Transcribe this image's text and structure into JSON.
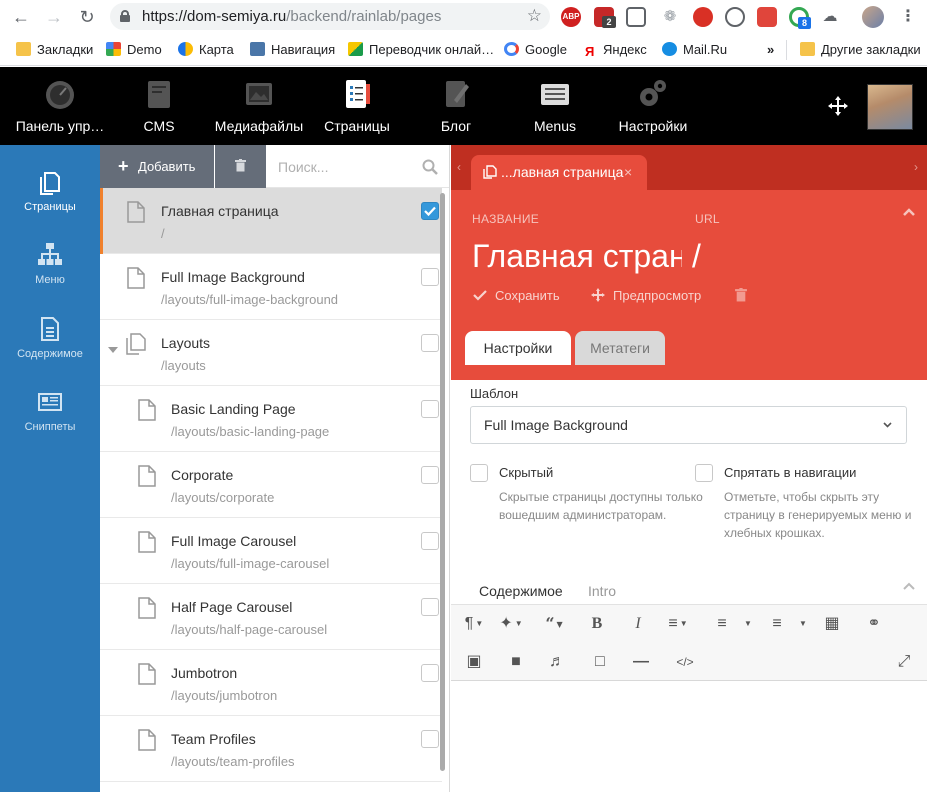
{
  "browser": {
    "url_host": "https://dom-semiya.ru",
    "url_path": "/backend/rainlab/pages",
    "extension_badge_1": "2",
    "extension_badge_2": "8",
    "adblock_label": "ABP",
    "bookmarks": [
      {
        "label": "Закладки"
      },
      {
        "label": "Demo"
      },
      {
        "label": "Карта"
      },
      {
        "label": "Навигация"
      },
      {
        "label": "Переводчик онлай…"
      },
      {
        "label": "Google"
      },
      {
        "label": "Яндекс"
      },
      {
        "label": "Mail.Ru"
      }
    ],
    "overflow_label": "»",
    "other_bookmarks": "Другие закладки"
  },
  "topnav": {
    "items": [
      {
        "label": "Панель упр…",
        "icon": "dashboard-gauge-icon"
      },
      {
        "label": "CMS",
        "icon": "cms-icon"
      },
      {
        "label": "Медиафайлы",
        "icon": "media-icon"
      },
      {
        "label": "Страницы",
        "icon": "pages-icon"
      },
      {
        "label": "Блог",
        "icon": "blog-icon"
      },
      {
        "label": "Menus",
        "icon": "menus-icon"
      },
      {
        "label": "Настройки",
        "icon": "settings-gears-icon"
      }
    ]
  },
  "sidenav": {
    "items": [
      {
        "label": "Страницы",
        "icon": "pages-icon"
      },
      {
        "label": "Меню",
        "icon": "sitemap-icon"
      },
      {
        "label": "Содержимое",
        "icon": "content-icon"
      },
      {
        "label": "Сниппеты",
        "icon": "snippets-icon"
      }
    ]
  },
  "panel": {
    "add_label": "Добавить",
    "search_placeholder": "Поиск...",
    "pages": [
      {
        "title": "Главная страница",
        "path": "/",
        "selected": true,
        "checked": true
      },
      {
        "title": "Full Image Background",
        "path": "/layouts/full-image-background"
      },
      {
        "title": "Layouts",
        "path": "/layouts",
        "folder": true
      },
      {
        "title": "Basic Landing Page",
        "path": "/layouts/basic-landing-page"
      },
      {
        "title": "Corporate",
        "path": "/layouts/corporate"
      },
      {
        "title": "Full Image Carousel",
        "path": "/layouts/full-image-carousel"
      },
      {
        "title": "Half Page Carousel",
        "path": "/layouts/half-page-carousel"
      },
      {
        "title": "Jumbotron",
        "path": "/layouts/jumbotron"
      },
      {
        "title": "Team Profiles",
        "path": "/layouts/team-profiles"
      }
    ]
  },
  "editor": {
    "tab_title": "...лавная страница",
    "tab_close": "×",
    "name_label": "НАЗВАНИЕ",
    "url_label": "URL",
    "title_value": "Главная страница",
    "url_value": "/",
    "save_label": "Сохранить",
    "preview_label": "Предпросмотр",
    "form_tabs": [
      "Настройки",
      "Метатеги"
    ],
    "layout_label": "Шаблон",
    "layout_value": "Full Image Background",
    "hidden_title": "Скрытый",
    "hidden_help": "Скрытые страницы доступны только вошедшим администраторам.",
    "hide_nav_title": "Спрятать в навигации",
    "hide_nav_help": "Отметьте, чтобы скрыть эту страницу в генерируемых меню и хлебных крошках.",
    "content_tabs": [
      "Содержимое",
      "Intro"
    ]
  },
  "colors": {
    "topbar": "#000000",
    "sidenav": "#2b79b8",
    "editor_header": "#e74c3c",
    "editor_tabbar": "#bf2f21",
    "selected_accent": "#f0812d",
    "checkbox_checked": "#3498db"
  }
}
